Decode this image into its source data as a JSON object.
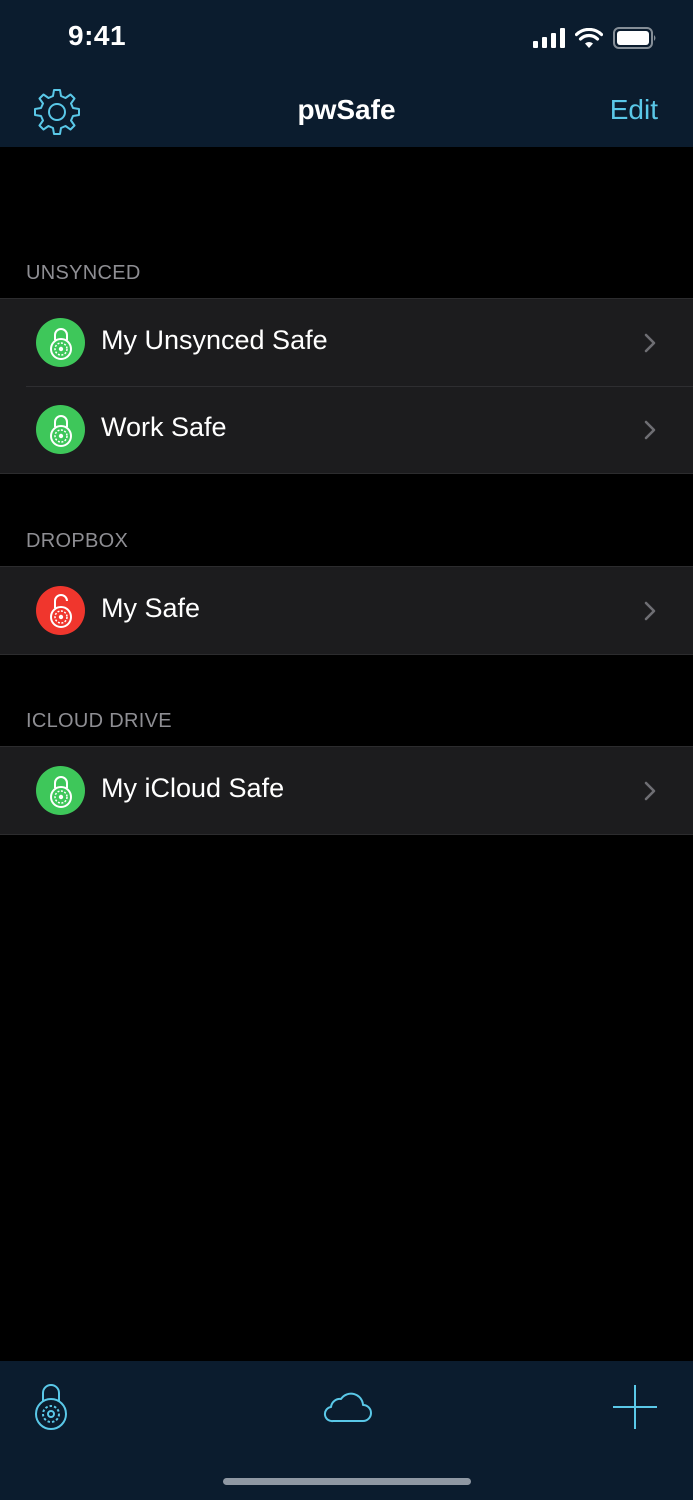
{
  "status_bar": {
    "time": "9:41"
  },
  "nav": {
    "title": "pwSafe",
    "edit_label": "Edit",
    "settings_icon": "gear-icon"
  },
  "sections": [
    {
      "header": "UNSYNCED",
      "items": [
        {
          "label": "My Unsynced Safe",
          "icon": "padlock-locked-icon",
          "color": "#3ec75a"
        },
        {
          "label": "Work Safe",
          "icon": "padlock-locked-icon",
          "color": "#3ec75a"
        }
      ]
    },
    {
      "header": "DROPBOX",
      "items": [
        {
          "label": "My Safe",
          "icon": "padlock-unlocked-icon",
          "color": "#f0362d"
        }
      ]
    },
    {
      "header": "ICLOUD DRIVE",
      "items": [
        {
          "label": "My iCloud Safe",
          "icon": "padlock-locked-icon",
          "color": "#3ec75a"
        }
      ]
    }
  ],
  "toolbar": {
    "left_icon": "padlock-icon",
    "center_icon": "cloud-icon",
    "right_icon": "plus-icon"
  },
  "colors": {
    "bar_background": "#0b1c2e",
    "accent": "#5ac8e8",
    "locked_green": "#3ec75a",
    "unlocked_red": "#f0362d"
  }
}
